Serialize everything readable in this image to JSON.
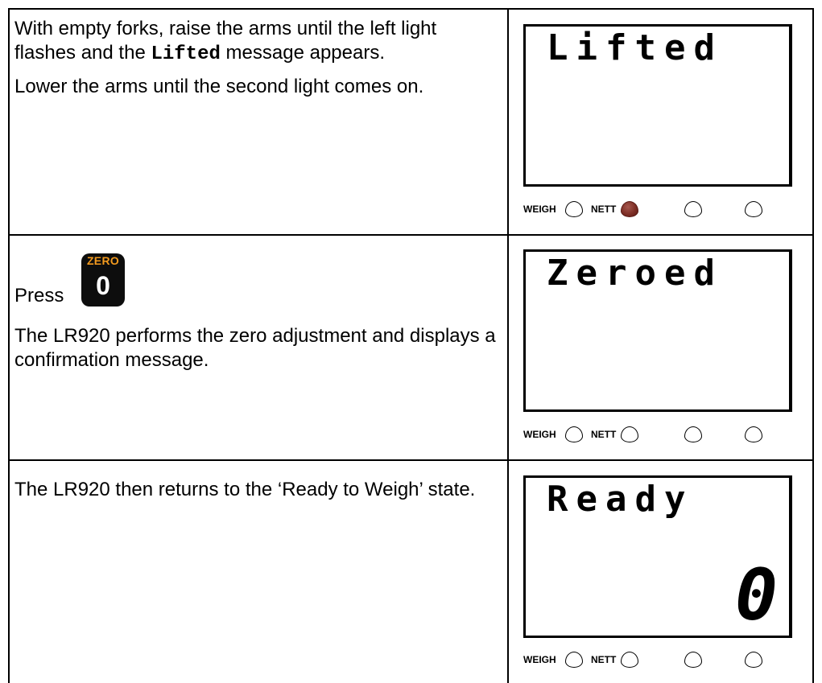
{
  "rows": [
    {
      "instructions": {
        "line1_prefix": "With empty forks, raise the arms until the left light flashes and the ",
        "line1_keyword": "Lifted",
        "line1_suffix": " message appears.",
        "line2": "Lower the arms until the second light comes on."
      },
      "display": {
        "message": "Lifted",
        "value": "",
        "lights": {
          "weigh_on": false,
          "nett_on": true,
          "light3_on": false,
          "light4_on": false
        }
      }
    },
    {
      "instructions": {
        "press_label": "Press",
        "key_caption": "ZERO",
        "key_digit": "0",
        "line2": "The LR920 performs the zero adjustment and displays a confirmation message."
      },
      "display": {
        "message": "Zeroed",
        "value": "",
        "lights": {
          "weigh_on": false,
          "nett_on": false,
          "light3_on": false,
          "light4_on": false
        }
      }
    },
    {
      "instructions": {
        "line1": "The LR920 then returns to the ‘Ready to Weigh’ state."
      },
      "display": {
        "message": "Ready",
        "value": "0",
        "lights": {
          "weigh_on": false,
          "nett_on": false,
          "light3_on": false,
          "light4_on": false
        }
      }
    }
  ],
  "indicator_labels": {
    "weigh": "WEIGH",
    "nett": "NETT"
  },
  "colors": {
    "lamp_on": "#7e2f26",
    "key_caption": "#f39a1e",
    "key_body": "#0d0d0d"
  }
}
